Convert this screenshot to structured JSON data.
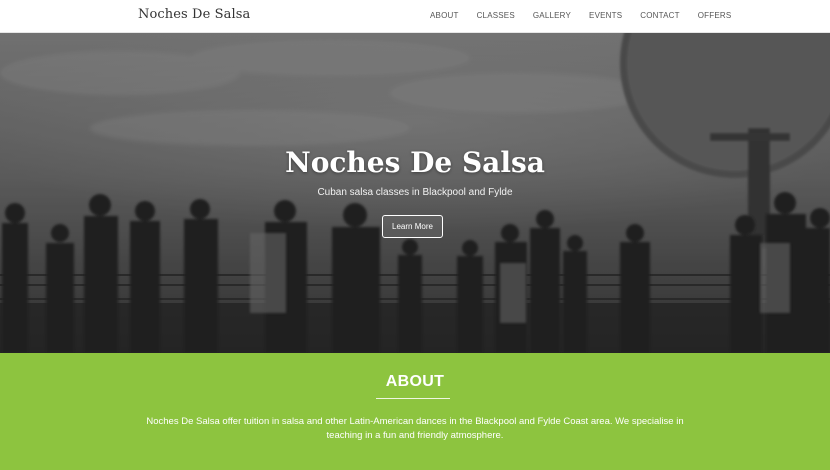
{
  "navbar": {
    "brand": "Noches De Salsa",
    "links": [
      "ABOUT",
      "CLASSES",
      "GALLERY",
      "EVENTS",
      "CONTACT",
      "OFFERS"
    ]
  },
  "hero": {
    "title": "Noches De Salsa",
    "subtitle": "Cuban salsa classes in Blackpool and Fylde",
    "button_label": "Learn More"
  },
  "about": {
    "heading": "ABOUT",
    "text": "Noches De Salsa offer tuition in salsa and other Latin-American dances in the Blackpool and Fylde Coast area. We specialise in teaching in a fun and friendly atmosphere."
  },
  "colors": {
    "about_background": "#8dc43f",
    "hero_overlay": "#5b5b5b",
    "navbar_background": "#ffffff"
  }
}
